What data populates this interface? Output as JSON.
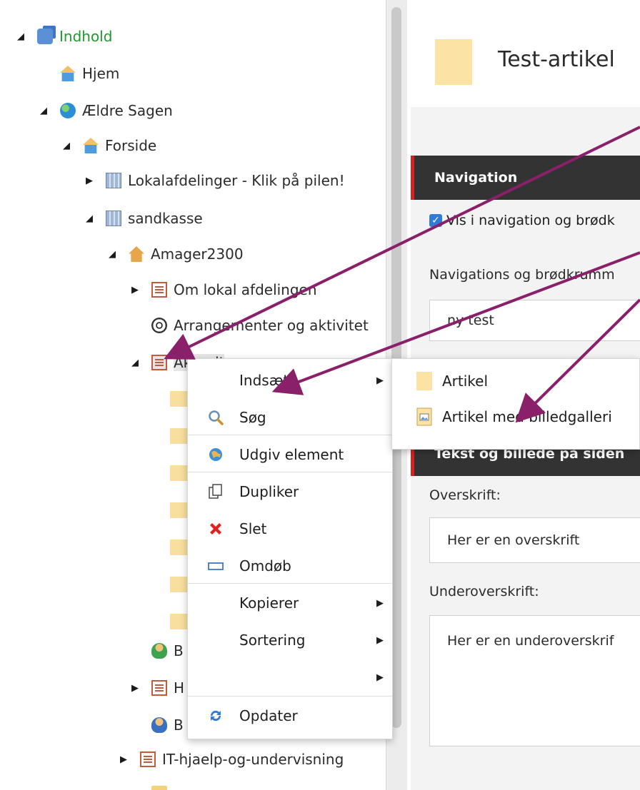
{
  "tree": {
    "root": "Indhold",
    "hjem": "Hjem",
    "site": "Ældre Sagen",
    "forside": "Forside",
    "lokal": "Lokalafdelinger - Klik på pilen!",
    "sandkasse": "sandkasse",
    "amager": "Amager2300",
    "om": "Om lokal afdelingen",
    "arr": "Arrangementer og aktivitet",
    "akt": "Aktuelt",
    "b1": "B",
    "h1": "H",
    "b2": "B",
    "it": "IT-hjaelp-og-undervisning"
  },
  "editor": {
    "page_title": "Test-artikel",
    "nav_section": "Navigation",
    "nav_checkbox": "Vis i navigation og brødk",
    "nav_label": "Navigations og brødkrumm",
    "nav_value": "ny test",
    "text_section": "Tekst og billede på siden",
    "heading_label": "Overskrift:",
    "heading_value": "Her er en overskrift",
    "subheading_label": "Underoverskrift:",
    "subheading_value": "Her er en underoverskrif"
  },
  "context_menu": {
    "insert": "Indsæt",
    "search": "Søg",
    "publish": "Udgiv element",
    "duplicate": "Dupliker",
    "delete": "Slet",
    "rename": "Omdøb",
    "copy": "Kopierer",
    "sort": "Sortering",
    "blank": "",
    "refresh": "Opdater"
  },
  "submenu": {
    "article": "Artikel",
    "article_gallery": "Artikel med billedgalleri"
  },
  "colors": {
    "accent_red": "#d42222",
    "arrow": "#8a1f6a",
    "root_green": "#1e9a2c"
  }
}
